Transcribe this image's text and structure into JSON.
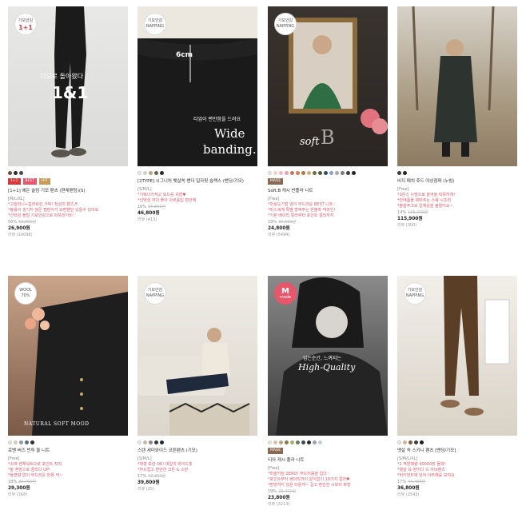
{
  "products": [
    {
      "badge_circle": [
        "기모안감",
        "1+1"
      ],
      "overlay": [
        "기모로 돌아왔다",
        "1&1"
      ],
      "swatches": [
        "#6b4e3d",
        "#2e2e2e",
        "#4c4c4c"
      ],
      "tags": [
        "1+1",
        "BEST",
        "HIT"
      ],
      "name": "[1+1] 에든 슬림 기모 팬츠 (편채팬팅)(S)",
      "size": "[M/L/XL]",
      "desc": [
        "*고밀리니+힙라워킨 가박! 장심미 팬츠♬",
        "*봉롤이 생기지 않은 캠핀어가 요편팬던 있을수 있어요",
        "*선택성 볼릴 기모안감으로 따뜻한가비♡"
      ],
      "discount": "50%",
      "orig_price": "53,800원",
      "price": "26,900원",
      "review": "리뷰 (10098)"
    },
    {
      "badge_circle": [
        "기모안감",
        "NAPPING"
      ],
      "overlay": [
        "6cm",
        "티업이 편안함을 드려요",
        "Wide",
        "banding."
      ],
      "swatches": [
        "#ecebe6",
        "#d8cfc4",
        "#b8a58b",
        "#6c6354",
        "#2b2b2b"
      ],
      "tags": [],
      "name": "[2TYPE] 시그니처 뱃살쏙 밴더 일자핏 슬랙스 (밴딩/기모)",
      "size": "[S/M/L]",
      "desc": [
        "*기쁘나가적고 모드를 귀찮♥",
        "*선택성 까지 좋아 아르용입 편안해"
      ],
      "discount": "16%",
      "orig_price": "55,800원",
      "price": "46,800원",
      "review": "리뷰 (413)"
    },
    {
      "badge_circle": [
        "기모안감",
        "NAPPING"
      ],
      "overlay": [
        "soft",
        "B"
      ],
      "swatches": [
        "#f0ece4",
        "#e8d3c7",
        "#f3b8c3",
        "#e9a2aa",
        "#c9735a",
        "#d47a52",
        "#a77a4d",
        "#c8b17c",
        "#6a6f45",
        "#4a5a3b",
        "#2f4c6b",
        "#86a5c9",
        "#a4a8b8",
        "#7a7a7a",
        "#3d3d3d",
        "#222"
      ],
      "tags": [
        "MADE"
      ],
      "name": "Soft.B 캐시 반폴라 니트",
      "size": "[Free]",
      "desc": [
        "*마실도기밤 양이 부드러운 BEST 니트♡",
        "*마스세계 특별 망짜주는 반불라 넥라인!",
        "*기본 베이직 컬러부터 포인트 컬러까지"
      ],
      "discount": "19%",
      "orig_price": "30,600원",
      "price": "24,800원",
      "review": "리뷰 (5494)"
    },
    {
      "badge_circle": [],
      "overlay": [],
      "swatches": [
        "#3a3f38",
        "#262626"
      ],
      "tags": [],
      "name": "비지 패치 후드 야상점퍼 (누빔)",
      "size": "[Free]",
      "desc": [
        "*3온스 누빔으로 올겨울 따뜻하게!",
        "*안에품을 제마주는 스퀘 시조리",
        "*볼을주고로 일체성을 불렸어요~"
      ],
      "discount": "14%",
      "orig_price": "135,000원",
      "price": "115,900원",
      "review": "리뷰 (300)"
    },
    {
      "badge_circle": [
        "WOOL",
        "70%"
      ],
      "overlay": [
        "NATURAL SOFT MOOD"
      ],
      "swatches": [
        "#e9e4d8",
        "#d9c8b5",
        "#8a9aa8",
        "#5a6e7e",
        "#2e2e2e"
      ],
      "tags": [],
      "name": "로벤 버즈 번투 울 니트",
      "size": "[Free]",
      "desc": [
        "*소매 켄체워트으로 포인트 직직",
        "*울 혼방으로 클리디 UP!",
        "*울편향 없이 부드러운 번폭 넥~"
      ],
      "discount": "18%",
      "orig_price": "35,700원",
      "price": "29,300원",
      "review": "리뷰 (168)"
    },
    {
      "badge_circle": [
        "기모안감",
        "NAPPING"
      ],
      "overlay": [],
      "swatches": [
        "#efeae0",
        "#c9b8a0",
        "#8a8a8a",
        "#3a3a3a",
        "#1f2a3c"
      ],
      "tags": [],
      "name": "스텐 세미와이드 코튼팬츠 (기모)",
      "size": "[S/M/L]",
      "desc": [
        "*체형 보완 OK! 데일리 와이드핏",
        "*부드럽고 편안한 코튼 & 스판"
      ],
      "discount": "17%",
      "orig_price": "47,800원",
      "price": "39,800원",
      "review": "리뷰 (25)"
    },
    {
      "badge_circle": [
        "M",
        "made"
      ],
      "overlay": [
        "입는순간, 느껴지는",
        "High-Quality"
      ],
      "swatches": [
        "#ece6da",
        "#d8c2ad",
        "#b9a58b",
        "#8b7b4a",
        "#a5b06f",
        "#6c7c5f",
        "#3c4a5c",
        "#2c2c2c",
        "#9aa2ae",
        "#c8ccd3"
      ],
      "tags": [
        "MADE"
      ],
      "name": "티아 캐시 폴라 니트",
      "size": "[Free]",
      "desc": [
        "*마술키밀 ZERO! 부드러움을 입다♡",
        "*포인트부터 베이직까지 알식없이 18가지 컬러♥",
        "*망망하지 않은 터틀넥~ 길고 편안한 시보리 파망"
      ],
      "discount": "19%",
      "orig_price": "29,400원",
      "price": "23,800원",
      "review": "리뷰 (3213)"
    },
    {
      "badge_circle": [
        "기모안감",
        "NAPPING"
      ],
      "overlay": [],
      "swatches": [
        "#efe9dd",
        "#cdb49b",
        "#7b6243",
        "#3d3d3d",
        "#1c1c1c"
      ],
      "tags": [],
      "name": "뱃살 쏙 스키니 팬츠 [밴딩/기모]",
      "size": "[S/M/L/XL]",
      "desc": [
        "*1 역판매량 40000장 돌파!",
        "*뱃살 쏙-장어다 드 아브팬츠",
        "*비키먼두에 넘어 아주해를 보여요"
      ],
      "discount": "17%",
      "orig_price": "44,400원",
      "price": "36,800원",
      "review": "리뷰 (2543)"
    }
  ]
}
